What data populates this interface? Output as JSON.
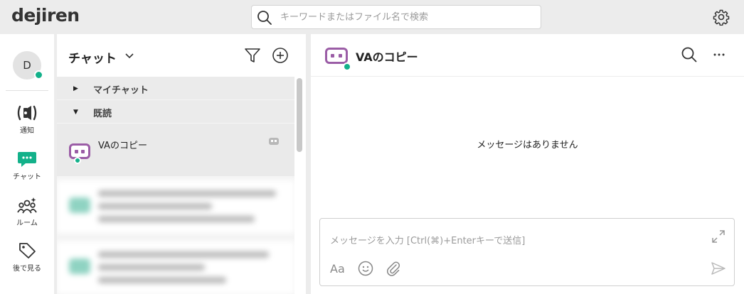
{
  "app": {
    "logo": "dejiren"
  },
  "search": {
    "placeholder": "キーワードまたはファイル名で検索"
  },
  "user": {
    "initial": "D"
  },
  "nav": [
    {
      "label": "通知"
    },
    {
      "label": "チャット"
    },
    {
      "label": "ルーム"
    },
    {
      "label": "後で見る"
    }
  ],
  "chat_list": {
    "title": "チャット",
    "sections": [
      {
        "title": "マイチャット"
      },
      {
        "title": "既読"
      }
    ],
    "selected_chat": {
      "name": "VAのコピー"
    }
  },
  "conversation": {
    "title": "VAのコピー",
    "empty_message": "メッセージはありません",
    "composer_placeholder": "メッセージを入力 [Ctrl(⌘)+Enterキーで送信]",
    "format_label": "Aa"
  },
  "colors": {
    "accent": "#13b18a",
    "bot_purple": "#9b5da6"
  }
}
